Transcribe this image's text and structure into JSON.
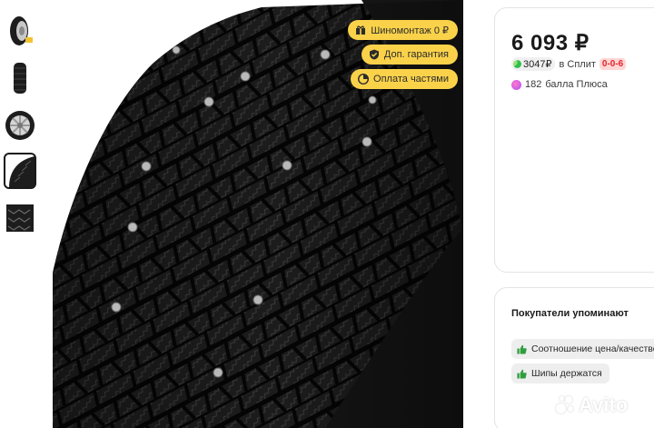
{
  "gallery": {
    "thumbnails": [
      {
        "name": "thumb-tire-angle",
        "active": false
      },
      {
        "name": "thumb-tire-side",
        "active": false
      },
      {
        "name": "thumb-wheel-rim",
        "active": false
      },
      {
        "name": "thumb-tread-closeup",
        "active": true
      },
      {
        "name": "thumb-tread-flat",
        "active": false
      }
    ],
    "badges": [
      {
        "label": "Шиномонтаж 0 ₽",
        "icon": "gift-icon"
      },
      {
        "label": "Доп. гарантия",
        "icon": "shield-icon"
      },
      {
        "label": "Оплата частями",
        "icon": "parts-payment-icon"
      }
    ]
  },
  "offer": {
    "price": "6 093 ₽",
    "split_amount": "3047₽",
    "split_label": "в Сплит",
    "split_schedule": "0-0-6",
    "plus_points": "182",
    "plus_label": "балла Плюса"
  },
  "mentions": {
    "title": "Покупатели упоминают",
    "tags": [
      "Соотношение цена/качество",
      "Шипы держатся"
    ]
  },
  "watermark": {
    "text": "Avito"
  },
  "colors": {
    "badge_bg": "#fad24a",
    "split_green": "#2fbf4a",
    "schedule_red": "#e0262b",
    "plus_purple": "#b04bff",
    "chip_icon_green": "#2e9e3e"
  }
}
